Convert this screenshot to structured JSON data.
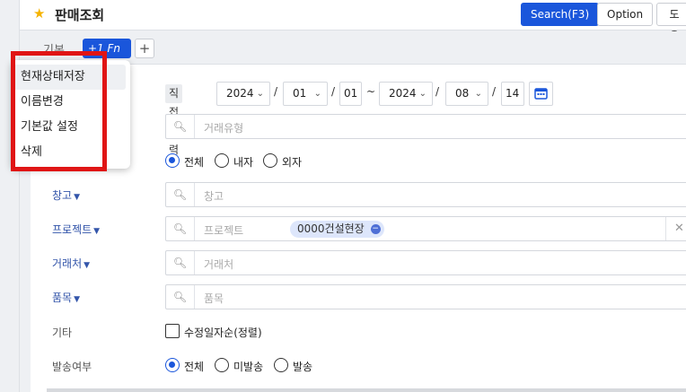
{
  "header": {
    "title": "판매조회",
    "search_label": "Search(F3)",
    "option_label": "Option",
    "help_label": "도움"
  },
  "tabs": {
    "basic_label": "기본",
    "fn_label": "+1  Fn",
    "add_label": "+"
  },
  "popup": {
    "items": [
      "현재상태저장",
      "이름변경",
      "기본값 설정",
      "삭제"
    ]
  },
  "date": {
    "mode_label": "직접입력",
    "start_year": "2024",
    "start_month": "01",
    "start_day": "01",
    "range_sep": "~",
    "end_year": "2024",
    "end_month": "08",
    "end_day": "14",
    "slash": "/"
  },
  "fields": {
    "transaction_type_placeholder": "거래유형",
    "warehouse_label": "창고",
    "warehouse_placeholder": "창고",
    "project_label": "프로젝트",
    "project_placeholder": "프로젝트",
    "project_chip": "0000건설현장",
    "customer_label": "거래처",
    "customer_placeholder": "거래처",
    "item_label": "품목",
    "item_placeholder": "품목"
  },
  "domestic": {
    "options": [
      "전체",
      "내자",
      "외자"
    ],
    "selected": "전체"
  },
  "other": {
    "label": "기타",
    "checkbox_label": "수정일자순(정렬)"
  },
  "shipping": {
    "label": "발송여부",
    "options": [
      "전체",
      "미발송",
      "발송"
    ],
    "selected": "전체"
  },
  "colors": {
    "primary": "#1a56db",
    "highlight_red": "#e01515",
    "star": "#f5b301"
  }
}
